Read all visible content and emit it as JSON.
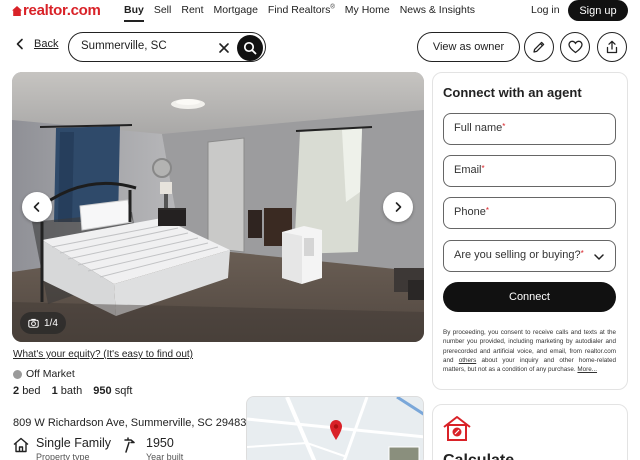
{
  "brand": {
    "logo_text": "realtor.com",
    "accent_color": "#d92228"
  },
  "nav": {
    "links": [
      {
        "label": "Buy",
        "active": true
      },
      {
        "label": "Sell"
      },
      {
        "label": "Rent"
      },
      {
        "label": "Mortgage"
      },
      {
        "label": "Find Realtors",
        "sup": "®"
      },
      {
        "label": "My Home"
      },
      {
        "label": "News & Insights"
      }
    ],
    "login": "Log in",
    "signup": "Sign up"
  },
  "toolbar": {
    "back_label": "Back",
    "search_value": "Summerville, SC",
    "view_owner": "View as owner",
    "icons": [
      "pencil-icon",
      "heart-icon",
      "share-icon"
    ]
  },
  "photo": {
    "counter": "1/4"
  },
  "listing": {
    "equity_link": "What's your equity? (It's easy to find out)",
    "status": "Off Market",
    "beds": "2",
    "beds_label": "bed",
    "baths": "1",
    "baths_label": "bath",
    "sqft": "950",
    "sqft_label": "sqft",
    "address": "809 W Richardson Ave, Summerville, SC 29483",
    "property_type": "Single Family",
    "property_type_label": "Property type",
    "year_built": "1950",
    "year_built_label": "Year built"
  },
  "agent_form": {
    "title": "Connect with an agent",
    "full_name": "Full name",
    "email": "Email",
    "phone": "Phone",
    "selling_buying": "Are you selling or buying?",
    "required_mark": "*",
    "connect": "Connect",
    "disclaimer_start": "By proceeding, you consent to receive calls and texts at the number you provided, including marketing by autodialer and prerecorded and artificial voice, and email, from realtor.com and ",
    "disclaimer_link": "others",
    "disclaimer_end": " about your inquiry and other home-related matters, but not as a condition of any purchase. ",
    "more_link": "More..."
  },
  "calculator": {
    "title_partial": "Calculate"
  }
}
